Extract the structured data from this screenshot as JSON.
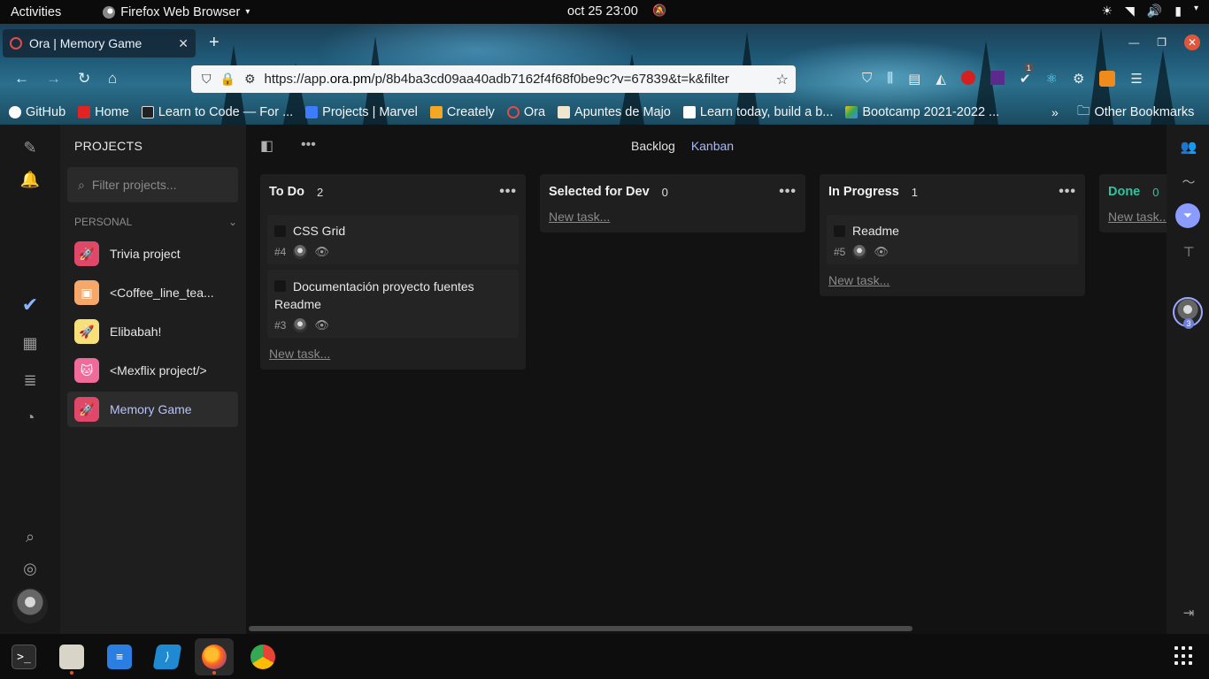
{
  "topbar": {
    "activities": "Activities",
    "app_name": "Firefox Web Browser",
    "clock": "oct 25  23:00"
  },
  "browser": {
    "tab_title": "Ora | Memory Game",
    "url_prefix": "https://app.",
    "url_domain": "ora.pm",
    "url_rest": "/p/8b4ba3cd09aa40adb7162f4f68f0be9c?v=67839&t=k&filter",
    "extension_badge": "1",
    "bookmarks": [
      {
        "label": "GitHub",
        "color": "#ffffff"
      },
      {
        "label": "Home",
        "color": "#e02424"
      },
      {
        "label": "Learn to Code — For ...",
        "color": "#222222"
      },
      {
        "label": "Projects | Marvel",
        "color": "#3d7bff"
      },
      {
        "label": "Creately",
        "color": "#f5a623"
      },
      {
        "label": "Ora",
        "color": "#e24b4b"
      },
      {
        "label": "Apuntes de Majo",
        "color": "#f0e6d0"
      },
      {
        "label": "Learn today, build a b...",
        "color": "#ffffff"
      },
      {
        "label": "Bootcamp 2021-2022 ...",
        "color": "#34a853"
      }
    ],
    "other_bookmarks": "Other Bookmarks"
  },
  "sidebar": {
    "title": "PROJECTS",
    "search_placeholder": "Filter projects...",
    "section": "PERSONAL",
    "projects": [
      {
        "label": "Trivia project",
        "color": "#e0486a"
      },
      {
        "label": "<Coffee_line_tea...",
        "color": "#f6a76a"
      },
      {
        "label": "Elibabah!",
        "color": "#f7e07a"
      },
      {
        "label": "<Mexflix project/>",
        "color": "#f06a9a"
      },
      {
        "label": "Memory Game",
        "color": "#e0486a"
      }
    ]
  },
  "main": {
    "views": [
      "Backlog",
      "Kanban"
    ],
    "active_view": "Kanban",
    "new_task_label": "New task...",
    "columns": [
      {
        "title": "To Do",
        "count": "2",
        "cards": [
          {
            "title": "CSS Grid",
            "id": "#4"
          },
          {
            "title": "Documentación proyecto fuentes Readme",
            "id": "#3"
          }
        ]
      },
      {
        "title": "Selected for Dev",
        "count": "0",
        "cards": []
      },
      {
        "title": "In Progress",
        "count": "1",
        "cards": [
          {
            "title": "Readme",
            "id": "#5"
          }
        ]
      },
      {
        "title": "Done",
        "count": "0",
        "cards": []
      }
    ],
    "done_color": "#2ec4a0"
  },
  "rightrail": {
    "member_count": "3"
  },
  "colors": {
    "accent": "#8a9cff",
    "active_text": "#a9b8ff",
    "background": "#121212"
  }
}
